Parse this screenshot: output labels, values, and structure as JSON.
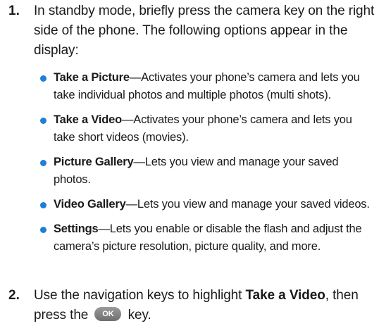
{
  "steps": [
    {
      "number": "1.",
      "text": "In standby mode, briefly press the camera key on the right side of the phone. The following options appear in the display:"
    },
    {
      "number": "2.",
      "text_before": "Use the navigation keys to highlight ",
      "bold": "Take a Video",
      "text_mid": ", then press the ",
      "key_label": "OK",
      "text_after": " key."
    }
  ],
  "options": [
    {
      "term": "Take a Picture",
      "description": "—Activates your phone’s camera and lets you take individual photos and multiple photos (multi shots)."
    },
    {
      "term": "Take a Video",
      "description": "—Activates your phone’s camera and lets you take short videos (movies)."
    },
    {
      "term": "Picture Gallery",
      "description": "—Lets you view and manage your saved photos."
    },
    {
      "term": "Video Gallery",
      "description": "—Lets you view and manage your saved videos."
    },
    {
      "term": "Settings",
      "description": "—Lets you enable or disable the flash and adjust the camera’s picture resolution, picture quality, and more."
    }
  ],
  "colors": {
    "bullet": "#1f7fd6"
  }
}
